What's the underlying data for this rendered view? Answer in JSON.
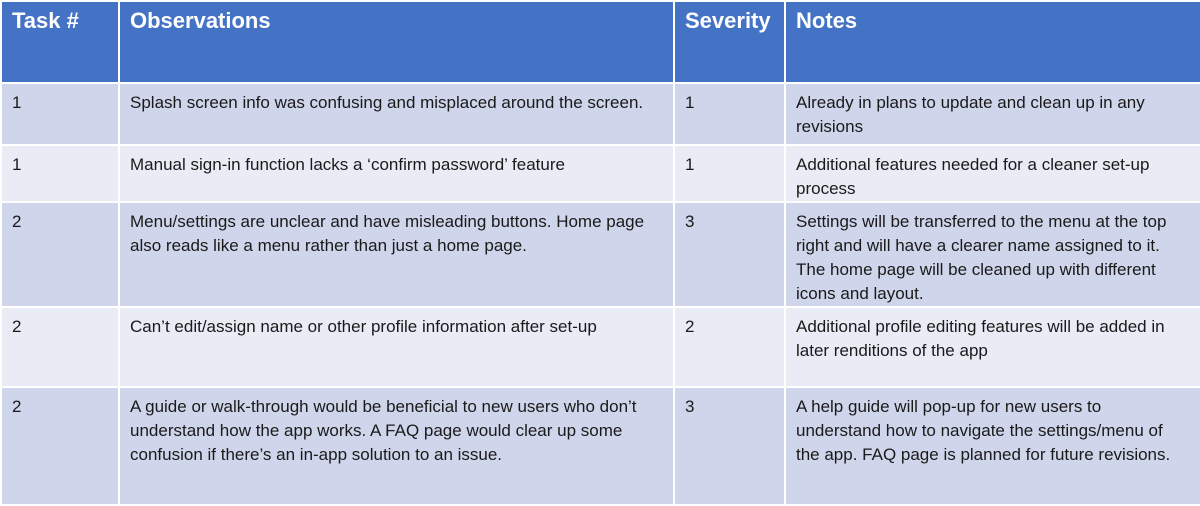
{
  "table": {
    "headers": [
      "Task #",
      "Observations",
      "Severity",
      "Notes"
    ],
    "rows": [
      {
        "task": "1",
        "observation": "Splash screen info was confusing and misplaced around the screen.",
        "severity": "1",
        "notes": "Already in plans to update and clean up in any revisions"
      },
      {
        "task": "1",
        "observation": "Manual sign-in function lacks a ‘confirm password’ feature",
        "severity": "1",
        "notes": "Additional features needed for a cleaner set-up process"
      },
      {
        "task": "2",
        "observation": "Menu/settings are unclear and have misleading buttons. Home page also reads like a menu rather than just a home page.",
        "severity": "3",
        "notes": "Settings will be transferred to the menu at the top right and will have a clearer name assigned to it. The home page will be cleaned up with different icons and layout."
      },
      {
        "task": "2",
        "observation": "Can’t edit/assign name or other profile information after set-up",
        "severity": "2",
        "notes": "Additional profile editing features will be added in later renditions of the app"
      },
      {
        "task": "2",
        "observation": "A guide or walk-through would be beneficial to new users who don’t understand how the app works. A FAQ page would clear up some confusion if there’s an in-app solution to an issue.",
        "severity": "3",
        "notes": "A help guide will pop-up for new users to understand how to navigate the settings/menu of the app. FAQ page is planned for future revisions."
      }
    ]
  },
  "colors": {
    "header_bg": "#4472c4",
    "row_odd_bg": "#cfd5ea",
    "row_even_bg": "#e9ebf5"
  }
}
